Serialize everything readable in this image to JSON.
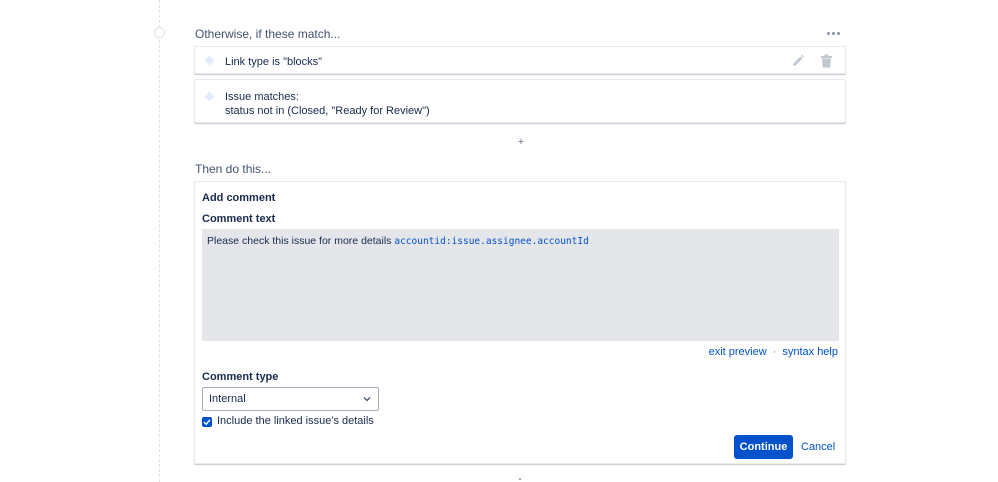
{
  "conditions": {
    "heading": "Otherwise, if these match...",
    "items": [
      {
        "label": "Link type is \"blocks\""
      },
      {
        "line1": "Issue matches:",
        "line2": "status not in (Closed, \"Ready for Review\")"
      }
    ],
    "add_symbol": "+"
  },
  "actions": {
    "heading": "Then do this...",
    "add_comment": {
      "title": "Add comment",
      "comment_text_label": "Comment text",
      "preview_text": "Please check this issue for more details ",
      "smart_value": "accountid:issue.assignee.accountId",
      "exit_preview": "exit preview",
      "separator": "·",
      "syntax_help": "syntax help",
      "comment_type_label": "Comment type",
      "comment_type_value": "Internal",
      "include_linked_label": "Include the linked issue's details",
      "include_linked_checked": true,
      "continue_label": "Continue",
      "cancel_label": "Cancel"
    }
  },
  "icons": {
    "more": "more-horizontal-icon",
    "edit": "pencil-icon",
    "delete": "trash-icon",
    "dropdown": "chevron-down-icon",
    "check": "checkmark-icon"
  },
  "colors": {
    "primary": "#0052cc",
    "text": "#172b4d",
    "subtle": "#42526e",
    "preview_bg": "#e4e6ea"
  }
}
